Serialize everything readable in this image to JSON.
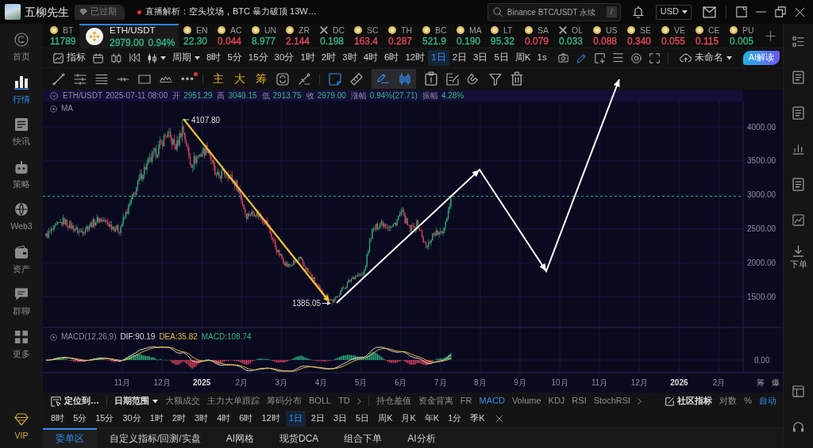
{
  "title_bar": {
    "account_name": "五柳先生",
    "badge": "已过期",
    "news": "直播解析：空头坟场，BTC 暴力破顶 13W…",
    "search": {
      "placeholder": "Binance BTC/USDT 永续",
      "shortcut": "/"
    },
    "currency": "USD"
  },
  "sidebar": {
    "items": [
      {
        "kind": "home",
        "label": "首页",
        "selected": false
      },
      {
        "kind": "market",
        "label": "行情",
        "selected": true
      },
      {
        "kind": "news",
        "label": "快讯",
        "selected": false
      },
      {
        "kind": "strategy",
        "label": "策略",
        "selected": false
      },
      {
        "kind": "web3",
        "label": "Web3",
        "selected": false
      },
      {
        "kind": "assets",
        "label": "资产",
        "selected": false
      },
      {
        "kind": "chat",
        "label": "群聊",
        "selected": false
      },
      {
        "kind": "more",
        "label": "更多",
        "selected": false
      },
      {
        "kind": "vip",
        "label": "VIP",
        "selected": false
      }
    ]
  },
  "ticker": {
    "items": [
      {
        "symbol": "BT",
        "price": "11789",
        "color": "#33b684",
        "kind": "coin",
        "selected": false
      },
      {
        "symbol": "ETH/USDT",
        "price": "2979.00",
        "change": "0.94%",
        "color": "#33b684",
        "kind": "exchange",
        "selected": true
      },
      {
        "symbol": "EN",
        "price": "22.30",
        "color": "#33b684",
        "kind": "coin",
        "selected": false
      },
      {
        "symbol": "AC",
        "price": "0.044",
        "color": "#e2475c",
        "kind": "coin",
        "selected": false
      },
      {
        "symbol": "UN",
        "price": "8.977",
        "color": "#33b684",
        "kind": "coin",
        "selected": false
      },
      {
        "symbol": "ZR",
        "price": "2.144",
        "color": "#e2475c",
        "kind": "coin",
        "selected": false
      },
      {
        "symbol": "DC",
        "price": "0.198",
        "color": "#33b684",
        "kind": "cross",
        "selected": false
      },
      {
        "symbol": "SC",
        "price": "163.4",
        "color": "#e2475c",
        "kind": "coin",
        "selected": false
      },
      {
        "symbol": "TH",
        "price": "0.287",
        "color": "#e2475c",
        "kind": "coin",
        "selected": false
      },
      {
        "symbol": "BC",
        "price": "521.9",
        "color": "#33b684",
        "kind": "coin",
        "selected": false
      },
      {
        "symbol": "MA",
        "price": "0.190",
        "color": "#33b684",
        "kind": "coin",
        "selected": false
      },
      {
        "symbol": "LT",
        "price": "95.32",
        "color": "#33b684",
        "kind": "coin",
        "selected": false
      },
      {
        "symbol": "SA",
        "price": "0.079",
        "color": "#e2475c",
        "kind": "coin",
        "selected": false
      },
      {
        "symbol": "OL",
        "price": "0.033",
        "color": "#33b684",
        "kind": "cross",
        "selected": false
      },
      {
        "symbol": "US",
        "price": "0.088",
        "color": "#e2475c",
        "kind": "coin",
        "selected": false
      },
      {
        "symbol": "SE",
        "price": "0.340",
        "color": "#e2475c",
        "kind": "coin",
        "selected": false
      },
      {
        "symbol": "VE",
        "price": "0.055",
        "color": "#e2475c",
        "kind": "coin",
        "selected": false
      },
      {
        "symbol": "CE",
        "price": "0.115",
        "color": "#e2475c",
        "kind": "coin",
        "selected": false
      },
      {
        "symbol": "PU",
        "price": "0.005",
        "color": "#33b684",
        "kind": "coin",
        "selected": false
      }
    ]
  },
  "chart_toolbar": {
    "indicator_button": "指标",
    "period_menu": "周期",
    "periods": [
      {
        "label": "8时",
        "selected": false
      },
      {
        "label": "5分",
        "selected": false
      },
      {
        "label": "15分",
        "selected": false
      },
      {
        "label": "30分",
        "selected": false
      },
      {
        "label": "1时",
        "selected": false
      },
      {
        "label": "2时",
        "selected": false
      },
      {
        "label": "3时",
        "selected": false
      },
      {
        "label": "4时",
        "selected": false
      },
      {
        "label": "6时",
        "selected": false
      },
      {
        "label": "12时",
        "selected": false
      },
      {
        "label": "1日",
        "selected": true
      },
      {
        "label": "2日",
        "selected": false
      },
      {
        "label": "3日",
        "selected": false
      },
      {
        "label": "5日",
        "selected": false
      },
      {
        "label": "周K",
        "selected": false
      }
    ],
    "interval": "1s",
    "tools": [
      {
        "kind": "camera",
        "on": false
      },
      {
        "kind": "pencil",
        "on": true
      },
      {
        "kind": "frame",
        "on": false
      },
      {
        "kind": "lines",
        "on": false
      },
      {
        "kind": "target",
        "on": false
      },
      {
        "kind": "fullscreen",
        "on": false
      }
    ],
    "layout_name": "未命名",
    "ai_button": "AI解读"
  },
  "drawing_toolbar": {
    "tool_groups": [
      [
        {
          "kind": "trend-line",
          "on": false,
          "selected": false,
          "notification": false
        },
        {
          "kind": "fib-lines",
          "on": false,
          "selected": false,
          "notification": false
        },
        {
          "kind": "stacked-lines",
          "on": false,
          "selected": false,
          "notification": false
        },
        {
          "kind": "horizontal-line",
          "on": false,
          "selected": false,
          "notification": false
        },
        {
          "kind": "rectangle",
          "on": false,
          "selected": false,
          "notification": false
        },
        {
          "kind": "pattern",
          "on": false,
          "selected": false,
          "notification": false
        },
        {
          "kind": "more",
          "on": false,
          "selected": false,
          "notification": true
        }
      ],
      [
        {
          "kind": "text",
          "label": "主",
          "on": false,
          "selected": false,
          "notification": false
        },
        {
          "kind": "text",
          "label": "大",
          "on": false,
          "selected": false,
          "notification": false
        },
        {
          "kind": "text",
          "label": "筹",
          "on": false,
          "selected": false,
          "notification": false
        },
        {
          "kind": "refresh",
          "on": false,
          "selected": false,
          "notification": false
        },
        {
          "kind": "measure",
          "on": false,
          "selected": false,
          "notification": false
        }
      ],
      [
        {
          "kind": "note",
          "on": true,
          "selected": false,
          "notification": false
        },
        {
          "kind": "ruler",
          "on": false,
          "selected": false,
          "notification": false
        },
        {
          "kind": "pen",
          "on": true,
          "selected": true,
          "notification": false
        },
        {
          "kind": "candles",
          "on": true,
          "selected": true,
          "notification": false
        },
        {
          "kind": "clipboard",
          "on": false,
          "selected": false,
          "notification": false
        },
        {
          "kind": "edit",
          "on": false,
          "selected": false,
          "notification": false
        },
        {
          "kind": "magnet",
          "on": false,
          "selected": false,
          "notification": false
        },
        {
          "kind": "filter",
          "on": false,
          "selected": false,
          "notification": false
        },
        {
          "kind": "trash",
          "on": false,
          "selected": false,
          "notification": false
        }
      ]
    ]
  },
  "chart": {
    "symbol": "ETH/USDT",
    "time": "2025-07-11 08:00",
    "quote": [
      {
        "label": "开",
        "value": "2951.29"
      },
      {
        "label": "高",
        "value": "3040.15"
      },
      {
        "label": "低",
        "value": "2913.75"
      },
      {
        "label": "收",
        "value": "2979.00"
      },
      {
        "label": "涨幅",
        "value": "0.94%(27.71)"
      },
      {
        "label": "振幅",
        "value": "4.28%"
      }
    ],
    "overlay": "MA",
    "price_axis": [
      "4000.00",
      "3500.00",
      "3000.00",
      "2500.00",
      "2000.00",
      "1500.00"
    ],
    "high_label": "4107.80",
    "low_label": "1385.05",
    "macd": {
      "title": "MACD(12,26,9)",
      "values": [
        {
          "kind": "dif",
          "text": "DIF:90.19"
        },
        {
          "kind": "dea",
          "text": "DEA:35.82"
        },
        {
          "kind": "macd",
          "text": "MACD:108.74"
        }
      ],
      "axis": "0.00"
    },
    "time_axis": [
      {
        "label": "11月",
        "kind": "month"
      },
      {
        "label": "12月",
        "kind": "month"
      },
      {
        "label": "2025",
        "kind": "year"
      },
      {
        "label": "2月",
        "kind": "month"
      },
      {
        "label": "3月",
        "kind": "month"
      },
      {
        "label": "4月",
        "kind": "month"
      },
      {
        "label": "5月",
        "kind": "month"
      },
      {
        "label": "6月",
        "kind": "month"
      },
      {
        "label": "7月",
        "kind": "month"
      },
      {
        "label": "8月",
        "kind": "month"
      },
      {
        "label": "9月",
        "kind": "month"
      },
      {
        "label": "10月",
        "kind": "month"
      },
      {
        "label": "11月",
        "kind": "month"
      },
      {
        "label": "12月",
        "kind": "month"
      },
      {
        "label": "2026",
        "kind": "year"
      },
      {
        "label": "2月",
        "kind": "month"
      }
    ],
    "axis_buttons": [
      "筹",
      "爆"
    ]
  },
  "indicator_bar": {
    "locate_button": "定位到…",
    "date_range": "日期范围",
    "main_indicators": [
      {
        "label": "大额成交",
        "selected": false
      },
      {
        "label": "主力大单跟踪",
        "selected": false
      },
      {
        "label": "筹码分布",
        "selected": false
      },
      {
        "label": "BOLL",
        "selected": false
      },
      {
        "label": "TD",
        "selected": false
      }
    ],
    "sub_indicators": [
      {
        "label": "持仓差值",
        "selected": false
      },
      {
        "label": "资金背离",
        "selected": false
      },
      {
        "label": "FR",
        "selected": false
      },
      {
        "label": "MACD",
        "selected": true
      },
      {
        "label": "Volume",
        "selected": false
      },
      {
        "label": "KDJ",
        "selected": false
      },
      {
        "label": "RSI",
        "selected": false
      },
      {
        "label": "StochRSI",
        "selected": false
      }
    ],
    "community_button": "社区指标",
    "scale_options": [
      {
        "label": "对数",
        "selected": false
      },
      {
        "label": "%",
        "selected": false
      },
      {
        "label": "自动",
        "selected": true
      }
    ]
  },
  "period_bar": {
    "periods": [
      {
        "label": "8时",
        "selected": false
      },
      {
        "label": "5分",
        "selected": false
      },
      {
        "label": "15分",
        "selected": false
      },
      {
        "label": "30分",
        "selected": false
      },
      {
        "label": "1时",
        "selected": false
      },
      {
        "label": "2时",
        "selected": false
      },
      {
        "label": "3时",
        "selected": false
      },
      {
        "label": "4时",
        "selected": false
      },
      {
        "label": "6时",
        "selected": false
      },
      {
        "label": "12时",
        "selected": false
      },
      {
        "label": "1日",
        "selected": true
      },
      {
        "label": "2日",
        "selected": false
      },
      {
        "label": "3日",
        "selected": false
      },
      {
        "label": "5日",
        "selected": false
      },
      {
        "label": "周K",
        "selected": false
      },
      {
        "label": "月K",
        "selected": false
      },
      {
        "label": "年K",
        "selected": false
      },
      {
        "label": "1分",
        "selected": false
      },
      {
        "label": "季K",
        "selected": false
      }
    ]
  },
  "bottom_tabs": [
    {
      "label": "委单区",
      "selected": true
    },
    {
      "label": "自定义指标/回测/实盘",
      "selected": false
    },
    {
      "label": "AI网格",
      "selected": false
    },
    {
      "label": "现货DCA",
      "selected": false
    },
    {
      "label": "组合下单",
      "selected": false
    },
    {
      "label": "AI分析",
      "selected": false
    }
  ],
  "right_panel": {
    "order_label": "下单"
  }
}
